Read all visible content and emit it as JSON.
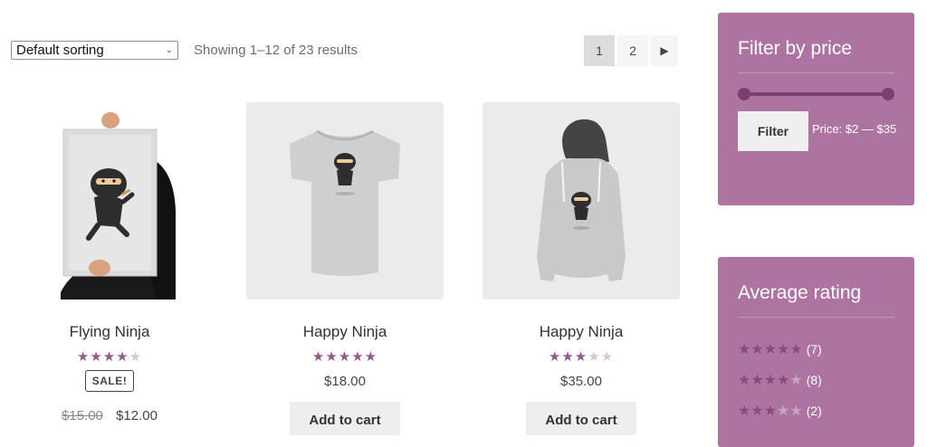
{
  "toolbar": {
    "sort_value": "Default sorting",
    "result_count": "Showing 1–12 of 23 results",
    "pages": [
      "1",
      "2"
    ],
    "current_page": "1",
    "next_icon": "triangle-right-icon"
  },
  "products": [
    {
      "title": "Flying Ninja",
      "rating": 4,
      "sale": true,
      "sale_label": "SALE!",
      "old_price": "$15.00",
      "price": "$12.00",
      "image": "ninja-poster"
    },
    {
      "title": "Happy Ninja",
      "rating": 5,
      "sale": false,
      "price": "$18.00",
      "button": "Add to cart",
      "image": "ninja-tshirt"
    },
    {
      "title": "Happy Ninja",
      "rating": 3,
      "sale": false,
      "price": "$35.00",
      "button": "Add to cart",
      "image": "ninja-hoodie"
    }
  ],
  "price_filter": {
    "title": "Filter by price",
    "button": "Filter",
    "range_label": "Price: $2 — $35",
    "min": 2,
    "max": 35
  },
  "rating_filter": {
    "title": "Average rating",
    "rows": [
      {
        "stars": 5,
        "count": "(7)"
      },
      {
        "stars": 4,
        "count": "(8)"
      },
      {
        "stars": 3,
        "count": "(2)"
      }
    ]
  },
  "colors": {
    "accent": "#96588a",
    "widget_bg": "#ad74a2",
    "slider": "#7a3f6f"
  }
}
